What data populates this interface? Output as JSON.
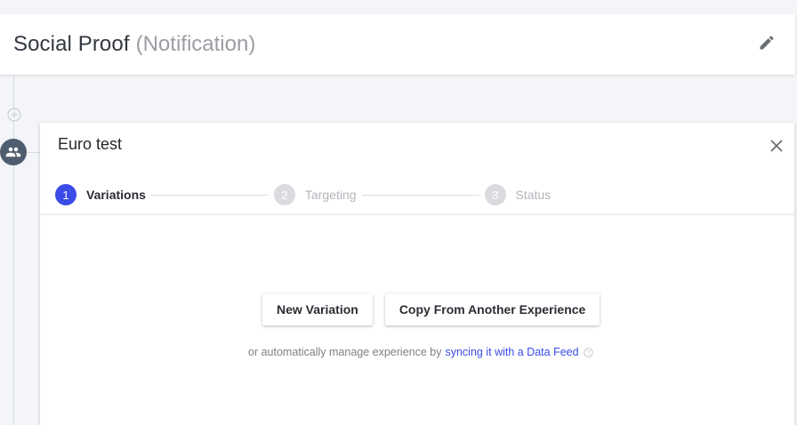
{
  "header": {
    "title": "Social Proof",
    "type_label": "(Notification)",
    "edit_icon": "pencil-icon"
  },
  "tree": {
    "add_icon": "plus-circle-icon",
    "audience_icon": "people-icon"
  },
  "experience": {
    "title": "Euro test",
    "close_icon": "close-icon",
    "steps": [
      {
        "number": "1",
        "label": "Variations",
        "state": "active"
      },
      {
        "number": "2",
        "label": "Targeting",
        "state": "inactive"
      },
      {
        "number": "3",
        "label": "Status",
        "state": "inactive"
      }
    ],
    "actions": {
      "new_variation": "New Variation",
      "copy_experience": "Copy From Another Experience"
    },
    "sync": {
      "text": "or automatically manage experience by",
      "link": "syncing it with a Data Feed",
      "help_icon": "help-circle-icon"
    }
  },
  "colors": {
    "accent": "#3a4be8",
    "background": "#f3f5f8",
    "avatar": "#4f5e6e"
  }
}
